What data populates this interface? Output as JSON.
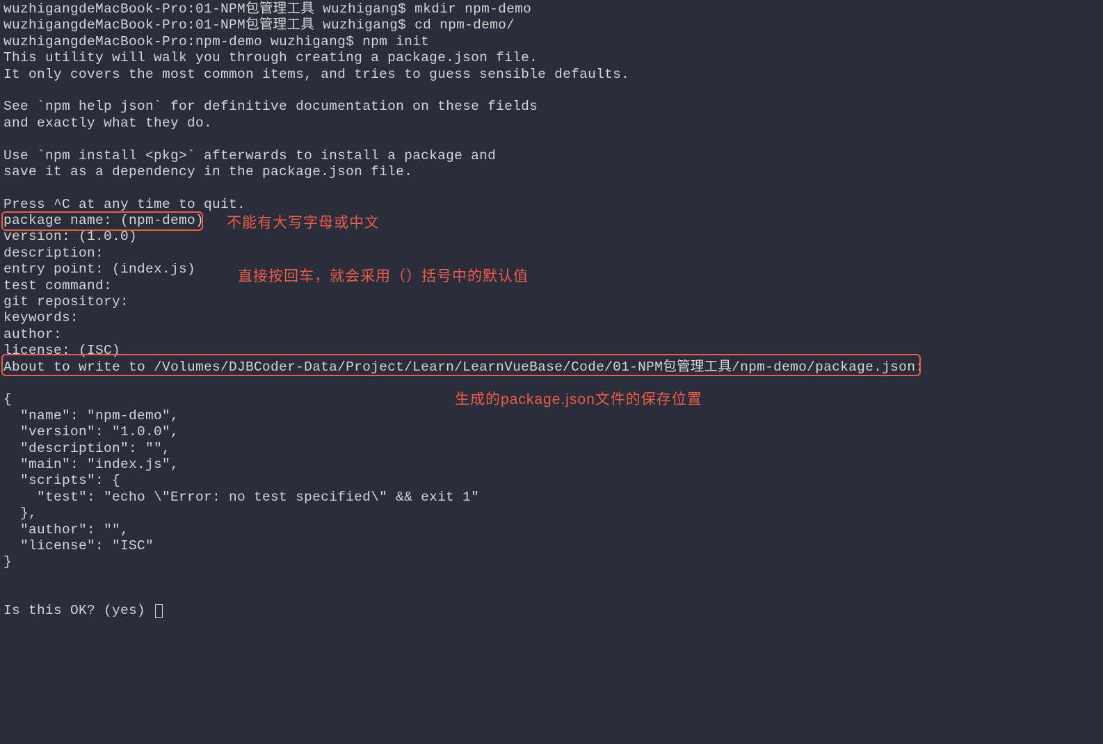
{
  "terminal": {
    "lines": [
      "wuzhigangdeMacBook-Pro:01-NPM包管理工具 wuzhigang$ mkdir npm-demo",
      "wuzhigangdeMacBook-Pro:01-NPM包管理工具 wuzhigang$ cd npm-demo/",
      "wuzhigangdeMacBook-Pro:npm-demo wuzhigang$ npm init",
      "This utility will walk you through creating a package.json file.",
      "It only covers the most common items, and tries to guess sensible defaults.",
      "",
      "See `npm help json` for definitive documentation on these fields",
      "and exactly what they do.",
      "",
      "Use `npm install <pkg>` afterwards to install a package and",
      "save it as a dependency in the package.json file.",
      "",
      "Press ^C at any time to quit.",
      "package name: (npm-demo) ",
      "version: (1.0.0) ",
      "description: ",
      "entry point: (index.js) ",
      "test command: ",
      "git repository: ",
      "keywords: ",
      "author: ",
      "license: (ISC) ",
      "About to write to /Volumes/DJBCoder-Data/Project/Learn/LearnVueBase/Code/01-NPM包管理工具/npm-demo/package.json:",
      "",
      "{",
      "  \"name\": \"npm-demo\",",
      "  \"version\": \"1.0.0\",",
      "  \"description\": \"\",",
      "  \"main\": \"index.js\",",
      "  \"scripts\": {",
      "    \"test\": \"echo \\\"Error: no test specified\\\" && exit 1\"",
      "  },",
      "  \"author\": \"\",",
      "  \"license\": \"ISC\"",
      "}",
      "",
      "",
      "Is this OK? (yes) "
    ]
  },
  "annotations": {
    "note1": "不能有大写字母或中文",
    "note2": "直接按回车，就会采用（）括号中的默认值",
    "note3": "生成的package.json文件的保存位置"
  }
}
